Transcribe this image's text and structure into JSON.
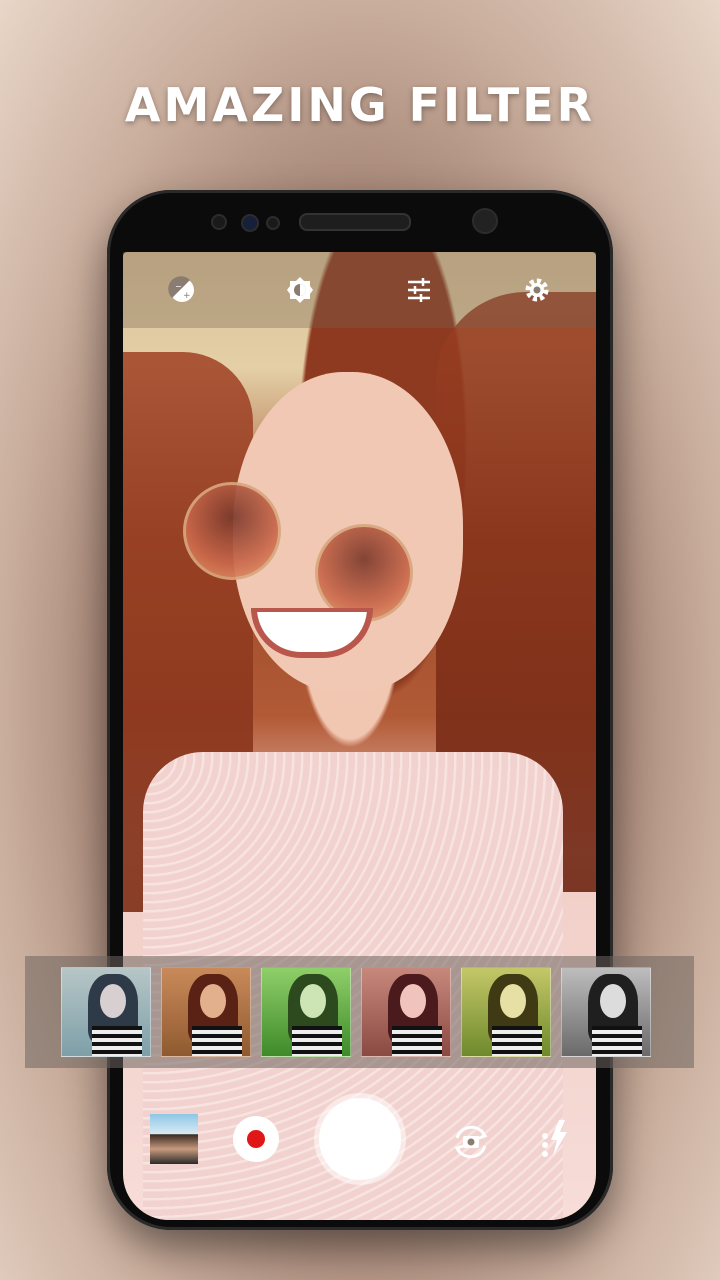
{
  "headline": "AMAZING FILTER",
  "top_controls": {
    "icons": [
      "exposure-icon",
      "brightness-icon",
      "adjust-sliders-icon",
      "settings-gear-icon"
    ]
  },
  "filters": [
    {
      "name": "filter-cool",
      "tint": "#6f8fa6"
    },
    {
      "name": "filter-warm",
      "tint": "#a4643e"
    },
    {
      "name": "filter-green",
      "tint": "#5d9a3e"
    },
    {
      "name": "filter-rose",
      "tint": "#a05a54"
    },
    {
      "name": "filter-yellow",
      "tint": "#9aa23c"
    },
    {
      "name": "filter-mono",
      "tint": "#777777"
    }
  ],
  "bottom_controls": {
    "icons": [
      "gallery-thumbnail",
      "record-video-icon",
      "shutter-button",
      "switch-camera-icon",
      "flash-icon"
    ]
  },
  "colors": {
    "record_red": "#e11717",
    "icon_white": "#ffffff"
  }
}
